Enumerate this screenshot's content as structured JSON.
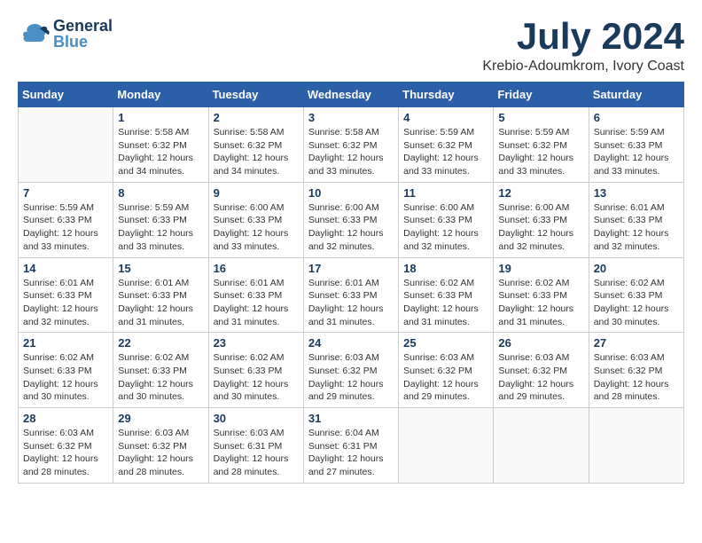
{
  "header": {
    "logo_general": "General",
    "logo_blue": "Blue",
    "month_title": "July 2024",
    "location": "Krebio-Adoumkrom, Ivory Coast"
  },
  "days_of_week": [
    "Sunday",
    "Monday",
    "Tuesday",
    "Wednesday",
    "Thursday",
    "Friday",
    "Saturday"
  ],
  "weeks": [
    {
      "days": [
        {
          "num": "",
          "info": ""
        },
        {
          "num": "1",
          "info": "Sunrise: 5:58 AM\nSunset: 6:32 PM\nDaylight: 12 hours\nand 34 minutes."
        },
        {
          "num": "2",
          "info": "Sunrise: 5:58 AM\nSunset: 6:32 PM\nDaylight: 12 hours\nand 34 minutes."
        },
        {
          "num": "3",
          "info": "Sunrise: 5:58 AM\nSunset: 6:32 PM\nDaylight: 12 hours\nand 33 minutes."
        },
        {
          "num": "4",
          "info": "Sunrise: 5:59 AM\nSunset: 6:32 PM\nDaylight: 12 hours\nand 33 minutes."
        },
        {
          "num": "5",
          "info": "Sunrise: 5:59 AM\nSunset: 6:32 PM\nDaylight: 12 hours\nand 33 minutes."
        },
        {
          "num": "6",
          "info": "Sunrise: 5:59 AM\nSunset: 6:33 PM\nDaylight: 12 hours\nand 33 minutes."
        }
      ]
    },
    {
      "days": [
        {
          "num": "7",
          "info": "Sunrise: 5:59 AM\nSunset: 6:33 PM\nDaylight: 12 hours\nand 33 minutes."
        },
        {
          "num": "8",
          "info": "Sunrise: 5:59 AM\nSunset: 6:33 PM\nDaylight: 12 hours\nand 33 minutes."
        },
        {
          "num": "9",
          "info": "Sunrise: 6:00 AM\nSunset: 6:33 PM\nDaylight: 12 hours\nand 33 minutes."
        },
        {
          "num": "10",
          "info": "Sunrise: 6:00 AM\nSunset: 6:33 PM\nDaylight: 12 hours\nand 32 minutes."
        },
        {
          "num": "11",
          "info": "Sunrise: 6:00 AM\nSunset: 6:33 PM\nDaylight: 12 hours\nand 32 minutes."
        },
        {
          "num": "12",
          "info": "Sunrise: 6:00 AM\nSunset: 6:33 PM\nDaylight: 12 hours\nand 32 minutes."
        },
        {
          "num": "13",
          "info": "Sunrise: 6:01 AM\nSunset: 6:33 PM\nDaylight: 12 hours\nand 32 minutes."
        }
      ]
    },
    {
      "days": [
        {
          "num": "14",
          "info": "Sunrise: 6:01 AM\nSunset: 6:33 PM\nDaylight: 12 hours\nand 32 minutes."
        },
        {
          "num": "15",
          "info": "Sunrise: 6:01 AM\nSunset: 6:33 PM\nDaylight: 12 hours\nand 31 minutes."
        },
        {
          "num": "16",
          "info": "Sunrise: 6:01 AM\nSunset: 6:33 PM\nDaylight: 12 hours\nand 31 minutes."
        },
        {
          "num": "17",
          "info": "Sunrise: 6:01 AM\nSunset: 6:33 PM\nDaylight: 12 hours\nand 31 minutes."
        },
        {
          "num": "18",
          "info": "Sunrise: 6:02 AM\nSunset: 6:33 PM\nDaylight: 12 hours\nand 31 minutes."
        },
        {
          "num": "19",
          "info": "Sunrise: 6:02 AM\nSunset: 6:33 PM\nDaylight: 12 hours\nand 31 minutes."
        },
        {
          "num": "20",
          "info": "Sunrise: 6:02 AM\nSunset: 6:33 PM\nDaylight: 12 hours\nand 30 minutes."
        }
      ]
    },
    {
      "days": [
        {
          "num": "21",
          "info": "Sunrise: 6:02 AM\nSunset: 6:33 PM\nDaylight: 12 hours\nand 30 minutes."
        },
        {
          "num": "22",
          "info": "Sunrise: 6:02 AM\nSunset: 6:33 PM\nDaylight: 12 hours\nand 30 minutes."
        },
        {
          "num": "23",
          "info": "Sunrise: 6:02 AM\nSunset: 6:33 PM\nDaylight: 12 hours\nand 30 minutes."
        },
        {
          "num": "24",
          "info": "Sunrise: 6:03 AM\nSunset: 6:32 PM\nDaylight: 12 hours\nand 29 minutes."
        },
        {
          "num": "25",
          "info": "Sunrise: 6:03 AM\nSunset: 6:32 PM\nDaylight: 12 hours\nand 29 minutes."
        },
        {
          "num": "26",
          "info": "Sunrise: 6:03 AM\nSunset: 6:32 PM\nDaylight: 12 hours\nand 29 minutes."
        },
        {
          "num": "27",
          "info": "Sunrise: 6:03 AM\nSunset: 6:32 PM\nDaylight: 12 hours\nand 28 minutes."
        }
      ]
    },
    {
      "days": [
        {
          "num": "28",
          "info": "Sunrise: 6:03 AM\nSunset: 6:32 PM\nDaylight: 12 hours\nand 28 minutes."
        },
        {
          "num": "29",
          "info": "Sunrise: 6:03 AM\nSunset: 6:32 PM\nDaylight: 12 hours\nand 28 minutes."
        },
        {
          "num": "30",
          "info": "Sunrise: 6:03 AM\nSunset: 6:31 PM\nDaylight: 12 hours\nand 28 minutes."
        },
        {
          "num": "31",
          "info": "Sunrise: 6:04 AM\nSunset: 6:31 PM\nDaylight: 12 hours\nand 27 minutes."
        },
        {
          "num": "",
          "info": ""
        },
        {
          "num": "",
          "info": ""
        },
        {
          "num": "",
          "info": ""
        }
      ]
    }
  ]
}
